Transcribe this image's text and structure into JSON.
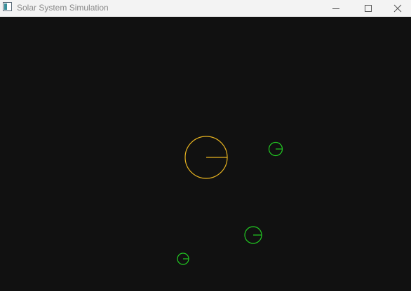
{
  "window": {
    "title": "Solar System Simulation"
  },
  "colors": {
    "titlebar_bg": "#f3f3f3",
    "canvas_bg": "#111111",
    "sun": "#e8b420",
    "planet": "#22cc22"
  },
  "bodies": [
    {
      "name": "sun",
      "icon": "sun-circle",
      "color": "#e8b420"
    },
    {
      "name": "planet-1",
      "icon": "planet-circle",
      "color": "#22cc22"
    },
    {
      "name": "planet-2",
      "icon": "planet-circle",
      "color": "#22cc22"
    },
    {
      "name": "planet-3",
      "icon": "planet-circle",
      "color": "#22cc22"
    }
  ]
}
